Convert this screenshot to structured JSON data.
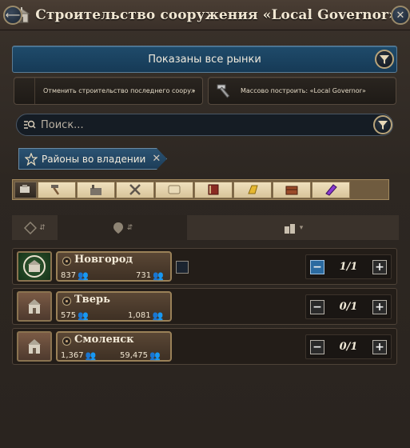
{
  "window": {
    "title": "Строительство сооружения «Local Governor»",
    "back_label": "⟵",
    "close_label": "✕"
  },
  "market_filter": {
    "label": "Показаны все рынки"
  },
  "actions": {
    "cancel_last": "Отменить строительство последнего сооружения «Lo...",
    "mass_build": "Массово построить: «Local Governor»"
  },
  "search": {
    "placeholder": "Поиск...",
    "value": ""
  },
  "filter_tag": {
    "label": "Районы во владении",
    "remove_label": "✕"
  },
  "category_icons": [
    "hammer-wrench-icon",
    "hammer-icon",
    "factory-icon",
    "crossed-tools-icon",
    "scroll-icon",
    "book-icon",
    "gold-bar-icon",
    "chest-icon",
    "crystal-icon"
  ],
  "colors": {
    "accent_blue": "#1f4b6b",
    "panel_bg": "#2b2520",
    "gold_border": "#9a8158"
  },
  "locations": [
    {
      "name": "Новгород",
      "population": "837",
      "workforce": "731",
      "count": "1/1",
      "owned": true,
      "minus_enabled": true
    },
    {
      "name": "Тверь",
      "population": "575",
      "workforce": "1,081",
      "count": "0/1",
      "owned": false,
      "minus_enabled": false
    },
    {
      "name": "Смоленск",
      "population": "1,367",
      "workforce": "59,475",
      "count": "0/1",
      "owned": false,
      "minus_enabled": false
    }
  ]
}
